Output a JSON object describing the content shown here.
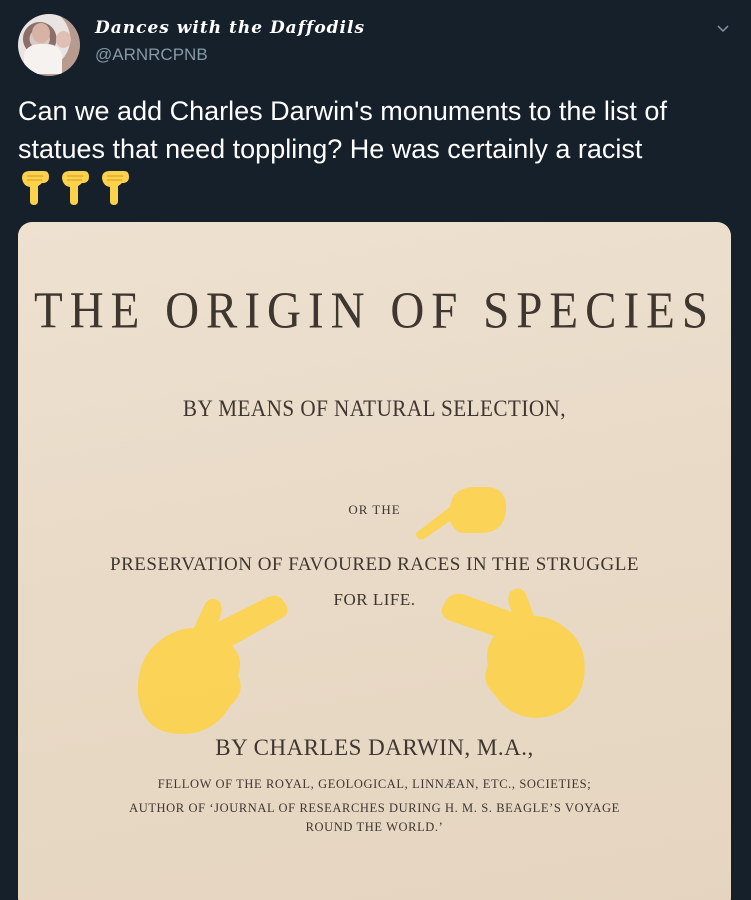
{
  "tweet": {
    "display_name": "Dances with the Daffodils",
    "handle": "@ARNRCPNB",
    "text": "Can we add Charles Darwin's monuments to the list of statues that need toppling?  He was certainly a racist",
    "emojis": [
      "pointing-down-icon",
      "pointing-down-icon",
      "pointing-down-icon"
    ],
    "menu_icon": "chevron-down-icon"
  },
  "media": {
    "title": "THE ORIGIN OF SPECIES",
    "subtitle": "BY MEANS OF NATURAL SELECTION,",
    "or_the": "OR THE",
    "preservation": "PRESERVATION OF FAVOURED RACES IN THE STRUGGLE",
    "for_life": "FOR LIFE.",
    "author": "BY CHARLES DARWIN, M.A.,",
    "fellow": "FELLOW OF THE ROYAL, GEOLOGICAL, LINNÆAN, ETC., SOCIETIES;",
    "author_of": "AUTHOR OF ‘JOURNAL OF RESEARCHES DURING H. M. S. BEAGLE’S VOYAGE",
    "round": "ROUND THE WORLD.’",
    "overlay_icons": [
      "pointing-hand-icon",
      "pointing-hand-icon",
      "pointing-hand-icon"
    ]
  },
  "colors": {
    "background": "#15202b",
    "text": "#ffffff",
    "secondary_text": "#8899a6",
    "page_paper": "#ebdccb",
    "print_ink": "#3e362f",
    "emoji_yellow": "#fcd24c"
  }
}
